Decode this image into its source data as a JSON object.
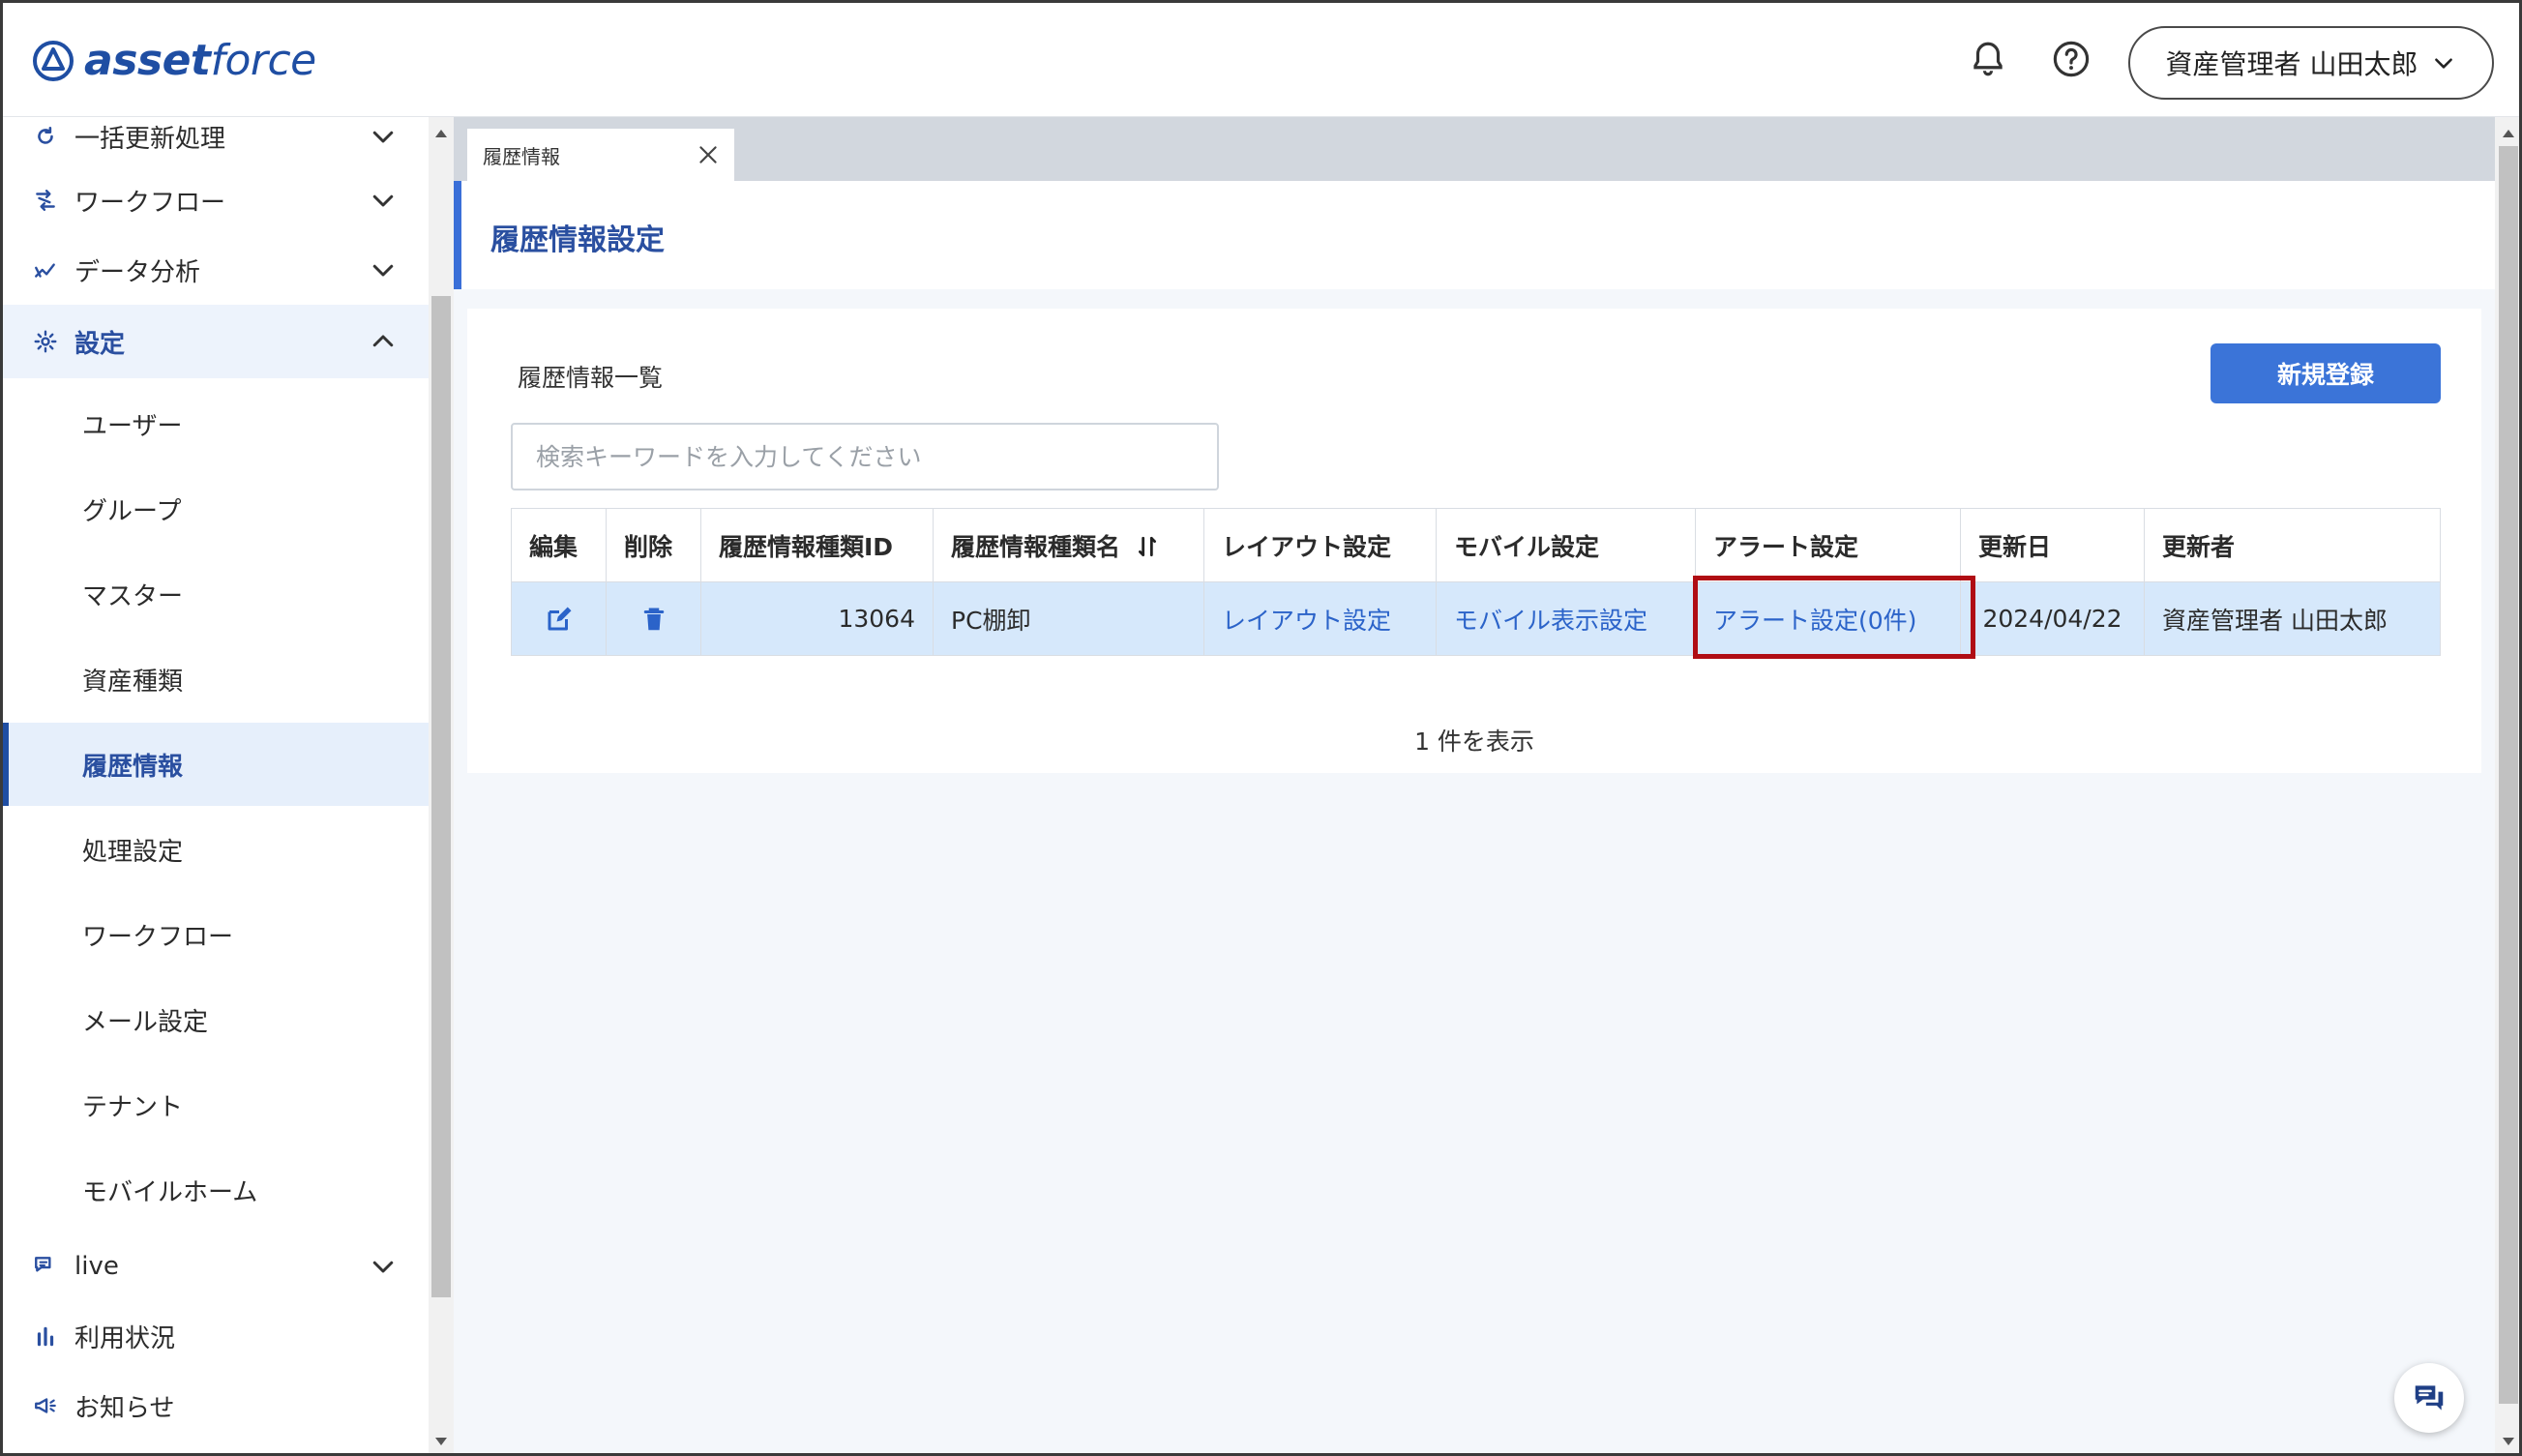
{
  "brand": {
    "name_bold": "asset",
    "name_light": "force",
    "color": "#1f4ea3"
  },
  "header": {
    "user_name": "資産管理者 山田太郎",
    "bell_icon": "bell-icon",
    "help_icon": "help-icon"
  },
  "sidebar": {
    "items": [
      {
        "label": "一括更新処理",
        "icon": "refresh-icon",
        "expandable": true,
        "expanded": false
      },
      {
        "label": "ワークフロー",
        "icon": "workflow-icon",
        "expandable": true,
        "expanded": false
      },
      {
        "label": "データ分析",
        "icon": "analytics-icon",
        "expandable": true,
        "expanded": false
      },
      {
        "label": "設定",
        "icon": "gear-icon",
        "expandable": true,
        "expanded": true
      },
      {
        "label": "ユーザー"
      },
      {
        "label": "グループ"
      },
      {
        "label": "マスター"
      },
      {
        "label": "資産種類"
      },
      {
        "label": "履歴情報",
        "active": true
      },
      {
        "label": "処理設定"
      },
      {
        "label": "ワークフロー"
      },
      {
        "label": "メール設定"
      },
      {
        "label": "テナント"
      },
      {
        "label": "モバイルホーム"
      },
      {
        "label": "live",
        "icon": "chat-icon",
        "expandable": true,
        "expanded": false
      },
      {
        "label": "利用状況",
        "icon": "bar-chart-icon"
      },
      {
        "label": "お知らせ",
        "icon": "megaphone-icon"
      }
    ]
  },
  "tabs": [
    {
      "label": "履歴情報"
    }
  ],
  "page": {
    "title": "履歴情報設定",
    "list_title": "履歴情報一覧",
    "new_button": "新規登録",
    "search_placeholder": "検索キーワードを入力してください",
    "count_text": "1 件を表示"
  },
  "table": {
    "headers": [
      "編集",
      "削除",
      "履歴情報種類ID",
      "履歴情報種類名",
      "レイアウト設定",
      "モバイル設定",
      "アラート設定",
      "更新日",
      "更新者"
    ],
    "rows": [
      {
        "id": "13064",
        "name": "PC棚卸",
        "layout_link": "レイアウト設定",
        "mobile_link": "モバイル表示設定",
        "alert_link": "アラート設定(0件)",
        "updated": "2024/04/22",
        "updater": "資産管理者 山田太郎"
      }
    ]
  },
  "colors": {
    "accent": "#3b74d8",
    "link": "#2b63c9",
    "row_selected": "#d6e8fb",
    "highlight_box": "#b00d14"
  }
}
